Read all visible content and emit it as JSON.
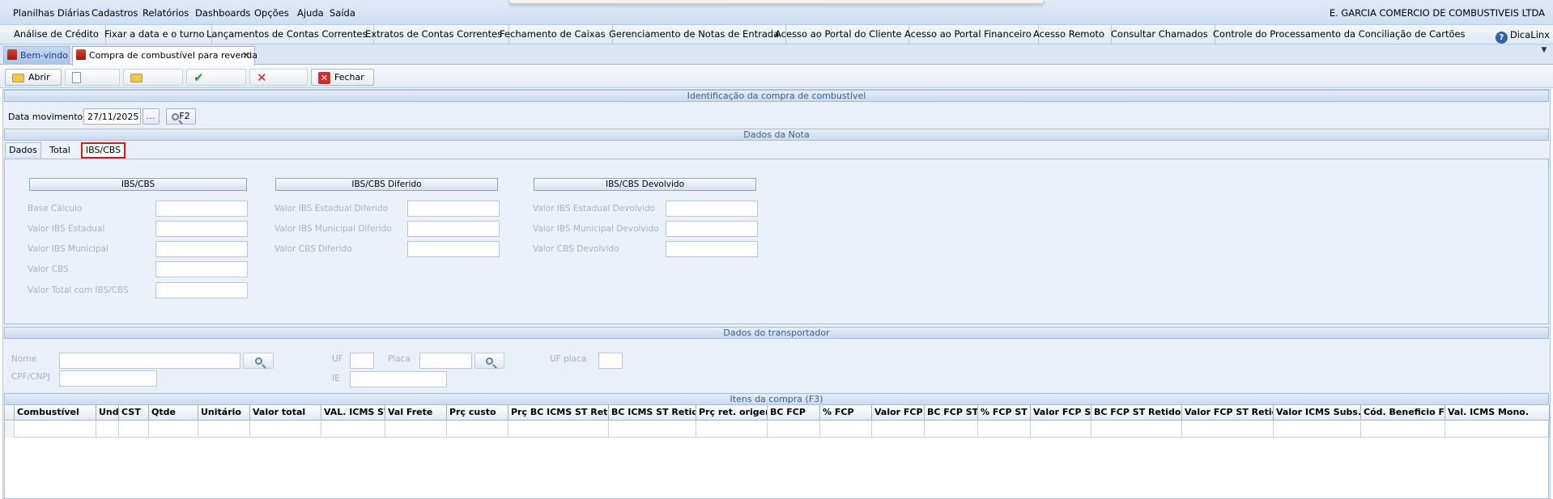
{
  "menubar": {
    "items": [
      "Planilhas Diárias",
      "Cadastros",
      "Relatórios",
      "Dashboards",
      "Opções",
      "Ajuda",
      "Saída"
    ],
    "company": "E. GARCIA COMERCIO DE COMBUSTIVEIS LTDA"
  },
  "shortcuts": {
    "items": [
      "Análise de Crédito",
      "Fixar a data e o turno",
      "Lançamentos de Contas Correntes",
      "Extratos de Contas Correntes",
      "Fechamento de Caixas",
      "Gerenciamento de Notas de Entrada",
      "Acesso ao Portal do Cliente",
      "Acesso ao Portal Financeiro",
      "Acesso Remoto",
      "Consultar Chamados",
      "Controle do Processamento da Conciliação de Cartões"
    ],
    "help": "DicaLinx"
  },
  "doctabs": {
    "welcome": "Bem-vindo",
    "compra": "Compra de combustível para revenda"
  },
  "toolbar": {
    "abrir": "Abrir",
    "fechar": "Fechar"
  },
  "identificacao": {
    "header": "Identificação da compra de combustível",
    "data_label": "Data movimento",
    "data_value": "27/11/2025",
    "f2": "F2"
  },
  "nota": {
    "header": "Dados da Nota",
    "tabs": [
      "Dados",
      "Total",
      "IBS/CBS"
    ]
  },
  "ibscbs": {
    "title": "IBS/CBS",
    "fields": [
      "Base Cálculo",
      "Valor IBS Estadual",
      "Valor IBS Municipal",
      "Valor CBS",
      "Valor Total com IBS/CBS"
    ]
  },
  "diferido": {
    "title": "IBS/CBS Diferido",
    "fields": [
      "Valor IBS Estadual Diferido",
      "Valor IBS Municipal Diferido",
      "Valor CBS Diferido"
    ]
  },
  "devolvido": {
    "title": "IBS/CBS Devolvido",
    "fields": [
      "Valor IBS Estadual Devolvido",
      "Valor IBS Municipal Devolvido",
      "Valor CBS Devolvido"
    ]
  },
  "transportador": {
    "header": "Dados do transportador",
    "nome": "Nome",
    "cpf": "CPF/CNPJ",
    "uf": "UF",
    "ie": "IE",
    "placa": "Placa",
    "uf_placa": "UF placa"
  },
  "itens": {
    "header": "Itens da compra (F3)",
    "columns": [
      "Combustível",
      "Und",
      "CST",
      "Qtde",
      "Unitário",
      "Valor total",
      "VAL. ICMS ST",
      "Val Frete",
      "Prç custo",
      "Prç BC ICMS ST Retid",
      "BC ICMS ST Retido",
      "Prç ret. origem",
      "BC FCP",
      "% FCP",
      "Valor FCP",
      "BC FCP ST",
      "% FCP ST",
      "Valor FCP ST",
      "BC FCP ST Retido",
      "Valor FCP ST Retido",
      "Valor ICMS Subs.",
      "Cód. Beneficio Fis",
      "Val. ICMS Mono."
    ]
  }
}
